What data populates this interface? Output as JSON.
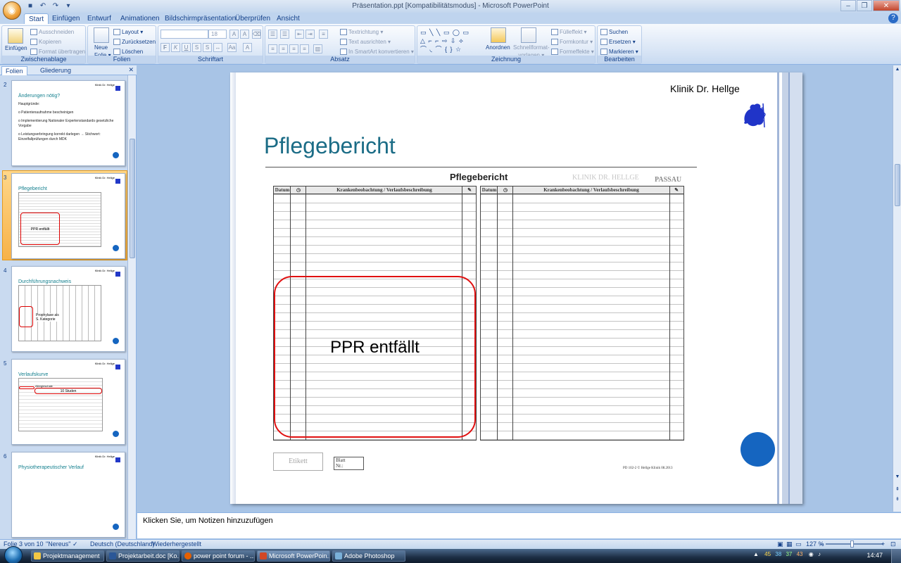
{
  "window": {
    "title": "Präsentation.ppt [Kompatibilitätsmodus] - Microsoft PowerPoint"
  },
  "ribbon_tabs": [
    "Start",
    "Einfügen",
    "Entwurf",
    "Animationen",
    "Bildschirmpräsentation",
    "Überprüfen",
    "Ansicht"
  ],
  "ribbon": {
    "clipboard": {
      "paste": "Einfügen",
      "cut": "Ausschneiden",
      "copy": "Kopieren",
      "format_painter": "Format übertragen",
      "label": "Zwischenablage"
    },
    "slides": {
      "new_slide_1": "Neue",
      "new_slide_2": "Folie",
      "layout": "Layout",
      "reset": "Zurücksetzen",
      "delete": "Löschen",
      "label": "Folien"
    },
    "font": {
      "size": "18",
      "label": "Schriftart"
    },
    "paragraph": {
      "text_direction": "Textrichtung",
      "align_text": "Text ausrichten",
      "smartart": "In SmartArt konvertieren",
      "label": "Absatz"
    },
    "drawing": {
      "arrange": "Anordnen",
      "quick_styles_1": "Schnellformat-",
      "quick_styles_2": "vorlagen",
      "fill": "Fülleffekt",
      "outline": "Formkontur",
      "effects": "Formeffekte",
      "label": "Zeichnung"
    },
    "editing": {
      "find": "Suchen",
      "replace": "Ersetzen",
      "select": "Markieren",
      "label": "Bearbeiten"
    }
  },
  "left_pane": {
    "tabs": [
      "Folien",
      "Gliederung"
    ],
    "slides": [
      {
        "number": "2",
        "clinic": "Klinik Dr. Hellge",
        "title": "Änderungen nötig?",
        "body": [
          "Hauptgründe:",
          "o Patientenaufnahme   bescheinigen",
          "o Implementierung  Nationaler  Expertenstandards gesetzliche Vorgabe",
          "o Leistungserbringung  korrekt darlegen  → Stichwort: Einzelfallprüfungen  durch  MDK"
        ]
      },
      {
        "number": "3",
        "clinic": "Klinik Dr. Hellge",
        "title": "Pflegebericht",
        "note": "PPR entfällt"
      },
      {
        "number": "4",
        "clinic": "Klinik Dr. Hellge",
        "title": "Durchführungsnachweis",
        "note_1": "Prophylaxe  als",
        "note_2": "S. Kategorie"
      },
      {
        "number": "5",
        "clinic": "Klinik Dr. Hellge",
        "title": "Verlaufskurve",
        "note_1": "Allergieschale",
        "note_2": "10 Studen"
      },
      {
        "number": "6",
        "clinic": "Klinik Dr. Hellge",
        "title": "Physiotherapeutischer Verlauf"
      }
    ]
  },
  "slide": {
    "clinic": "Klinik Dr. Hellge",
    "title": "Pflegebericht",
    "form": {
      "heading": "Pflegebericht",
      "brand": "KLINIK DR. HELLGE",
      "location": "PASSAU",
      "col_date": "Datum",
      "col_obs": "Krankenbeobachtung / Verlaufsbeschreibung",
      "label_tag": "Etikett",
      "label_sheet": "Blatt",
      "label_no": "Nr.:",
      "footer": "PD 102-2  ©  Hellge Klinik 08.2013"
    },
    "highlight": "PPR entfällt"
  },
  "notes": {
    "placeholder": "Klicken Sie, um  Notizen hinzuzufügen"
  },
  "statusbar": {
    "slide_info": "Folie 3 von 10",
    "theme": "\"Nereus\"",
    "language": "Deutsch (Deutschland)",
    "status": "Wiederhergestellt",
    "zoom": "127 %"
  },
  "taskbar": {
    "items": [
      "Projektmanagement",
      "Projektarbeit.doc [Ko...",
      "power point forum - ...",
      "Microsoft PowerPoin...",
      "Adobe Photoshop"
    ],
    "tray": [
      "45",
      "38",
      "37",
      "43"
    ],
    "clock": "14:47"
  }
}
